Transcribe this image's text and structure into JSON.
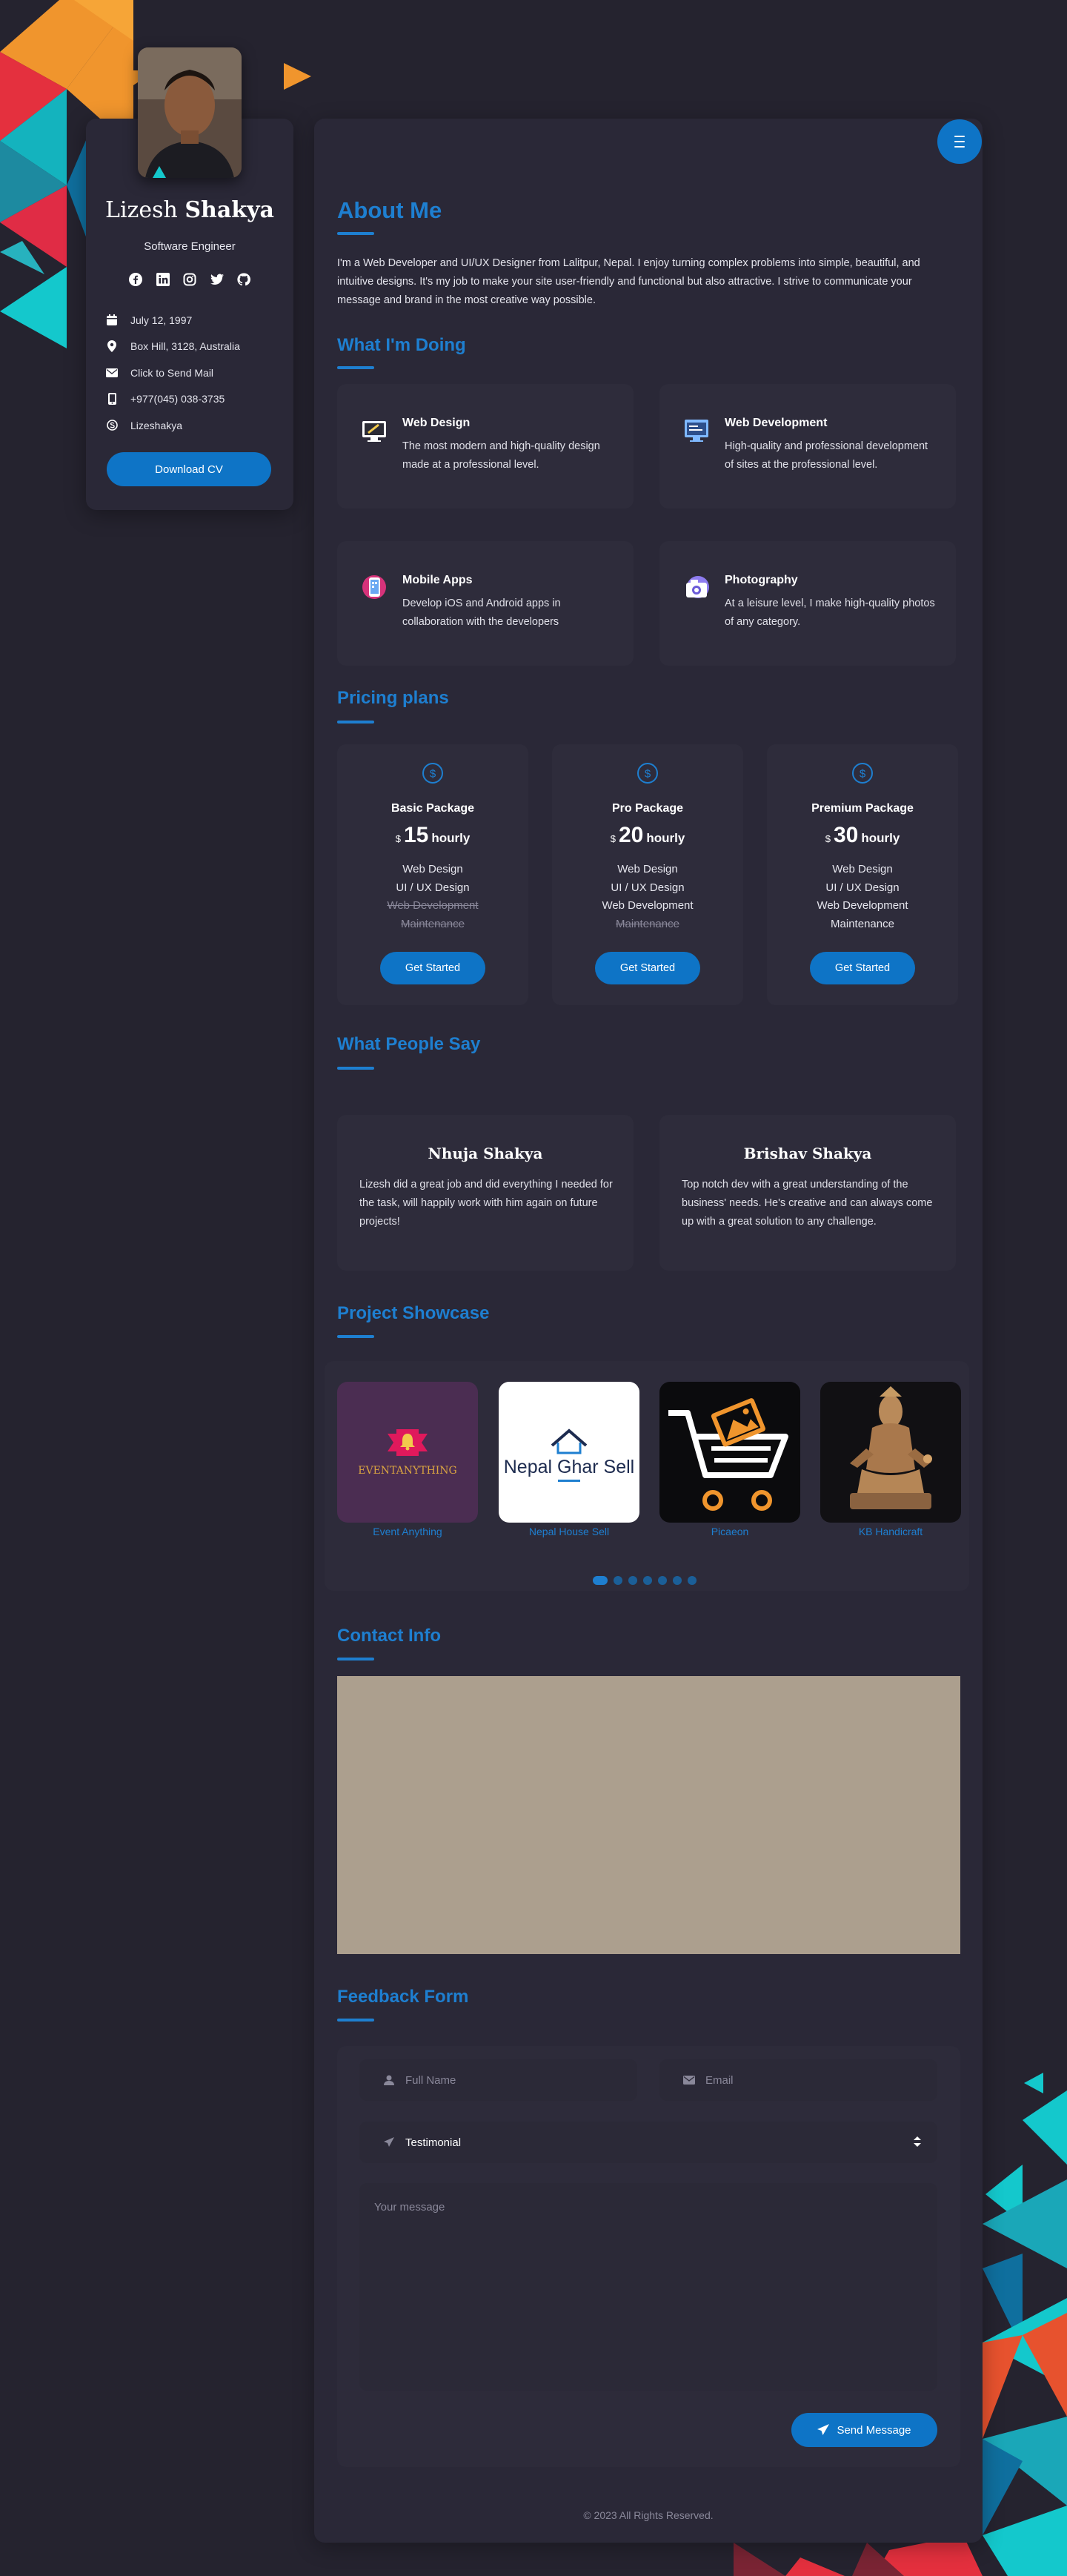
{
  "profile": {
    "first_name": "Lizesh",
    "last_name": "Shakya",
    "role": "Software Engineer",
    "socials": [
      "facebook-icon",
      "linkedin-icon",
      "instagram-icon",
      "twitter-icon",
      "github-icon"
    ],
    "info": [
      {
        "icon": "calendar-icon",
        "text": "July 12, 1997"
      },
      {
        "icon": "location-pin-icon",
        "text": "Box Hill, 3128, Australia"
      },
      {
        "icon": "envelope-icon",
        "text": "Click to Send Mail"
      },
      {
        "icon": "phone-icon",
        "text": "+977(045) 038-3735"
      },
      {
        "icon": "skype-icon",
        "text": "Lizeshakya"
      }
    ],
    "download_label": "Download CV"
  },
  "about": {
    "title": "About Me",
    "text": "I'm a Web Developer and UI/UX Designer from Lalitpur, Nepal. I enjoy turning complex problems into simple, beautiful, and intuitive designs. It's my job to make your site user-friendly and functional but also attractive. I strive to communicate your message and brand in the most creative way possible."
  },
  "services": {
    "title": "What I'm Doing",
    "items": [
      {
        "title": "Web Design",
        "text": "The most modern and high-quality design made at a professional level."
      },
      {
        "title": "Web Development",
        "text": "High-quality and professional development of sites at the professional level."
      },
      {
        "title": "Mobile Apps",
        "text": "Develop iOS and Android apps in collaboration with the developers"
      },
      {
        "title": "Photography",
        "text": "At a leisure level, I make high-quality photos of any category."
      }
    ]
  },
  "pricing": {
    "title": "Pricing plans",
    "plans": [
      {
        "name": "Basic Package",
        "currency": "$",
        "amount": "15",
        "period": "hourly",
        "features": [
          "Web Design",
          "UI / UX Design",
          "Web Development",
          "Maintenance"
        ],
        "included": [
          true,
          true,
          false,
          false
        ],
        "button": "Get Started"
      },
      {
        "name": "Pro Package",
        "currency": "$",
        "amount": "20",
        "period": "hourly",
        "features": [
          "Web Design",
          "UI / UX Design",
          "Web Development",
          "Maintenance"
        ],
        "included": [
          true,
          true,
          true,
          false
        ],
        "button": "Get Started"
      },
      {
        "name": "Premium Package",
        "currency": "$",
        "amount": "30",
        "period": "hourly",
        "features": [
          "Web Design",
          "UI / UX Design",
          "Web Development",
          "Maintenance"
        ],
        "included": [
          true,
          true,
          true,
          true
        ],
        "button": "Get Started"
      }
    ]
  },
  "testimonials": {
    "title": "What People Say",
    "items": [
      {
        "name": "Nhuja Shakya",
        "text": "Lizesh did a great job and did everything I needed for the task, will happily work with him again on future projects!"
      },
      {
        "name": "Brishav Shakya",
        "text": "Top notch dev with a great understanding of the business' needs. He's creative and can always come up with a great solution to any challenge."
      }
    ]
  },
  "projects": {
    "title": "Project Showcase",
    "items": [
      {
        "label": "Event Anything",
        "logo_text": "EVENTANYTHING"
      },
      {
        "label": "Nepal House Sell",
        "logo_text": "Nepal Ghar Sell"
      },
      {
        "label": "Picaeon",
        "logo_text": ""
      },
      {
        "label": "KB Handicraft",
        "logo_text": ""
      }
    ],
    "dot_count": 7,
    "active_dot": 0
  },
  "contact": {
    "title": "Contact Info"
  },
  "feedback": {
    "title": "Feedback Form",
    "name_placeholder": "Full Name",
    "email_placeholder": "Email",
    "select_value": "Testimonial",
    "message_placeholder": "Your message",
    "send_label": "Send Message"
  },
  "footer": {
    "text": "© 2023 All Rights Reserved."
  },
  "colors": {
    "accent": "#1e7fd0",
    "button": "#0e74c6",
    "background": "#25232f",
    "card": "#2a2837"
  }
}
